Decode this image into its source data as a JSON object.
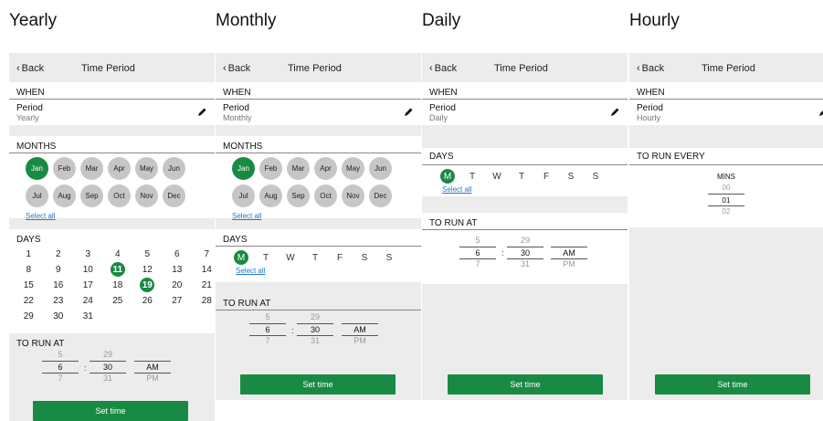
{
  "panel_titles": [
    "Yearly",
    "Monthly",
    "Daily",
    "Hourly"
  ],
  "topbar": {
    "back_label": "Back",
    "title": "Time Period"
  },
  "labels": {
    "when": "WHEN",
    "period": "Period",
    "months": "MONTHS",
    "days": "DAYS",
    "to_run_at": "TO RUN AT",
    "to_run_every": "TO RUN EVERY",
    "select_all": "Select all",
    "set_time": "Set time",
    "mins": "MINS"
  },
  "period_values": {
    "yearly": "Yearly",
    "monthly": "Monthly",
    "daily": "Daily",
    "hourly": "Hourly"
  },
  "months": [
    "Jan",
    "Feb",
    "Mar",
    "Apr",
    "May",
    "Jun",
    "Jul",
    "Aug",
    "Sep",
    "Oct",
    "Nov",
    "Dec"
  ],
  "selected_month": "Jan",
  "calendar_days": [
    "1",
    "2",
    "3",
    "4",
    "5",
    "6",
    "7",
    "8",
    "9",
    "10",
    "11",
    "12",
    "13",
    "14",
    "15",
    "16",
    "17",
    "18",
    "19",
    "20",
    "21",
    "22",
    "23",
    "24",
    "25",
    "26",
    "27",
    "28",
    "29",
    "30",
    "31"
  ],
  "selected_days": [
    "11",
    "19"
  ],
  "weekdays": [
    "M",
    "T",
    "W",
    "T",
    "F",
    "S",
    "S"
  ],
  "selected_weekday_index": 0,
  "time_picker": {
    "hour": {
      "prev": "5",
      "current": "6",
      "next": "7"
    },
    "minute": {
      "prev": "29",
      "current": "30",
      "next": "31"
    },
    "ampm": {
      "current": "AM",
      "next": "PM"
    },
    "separator": ":"
  },
  "minutes_picker": {
    "prev": "00",
    "current": "01",
    "next": "02"
  },
  "colors": {
    "accent": "#198a43",
    "link": "#2277cc",
    "chip": "#c6c6c6",
    "background": "#ececec"
  }
}
